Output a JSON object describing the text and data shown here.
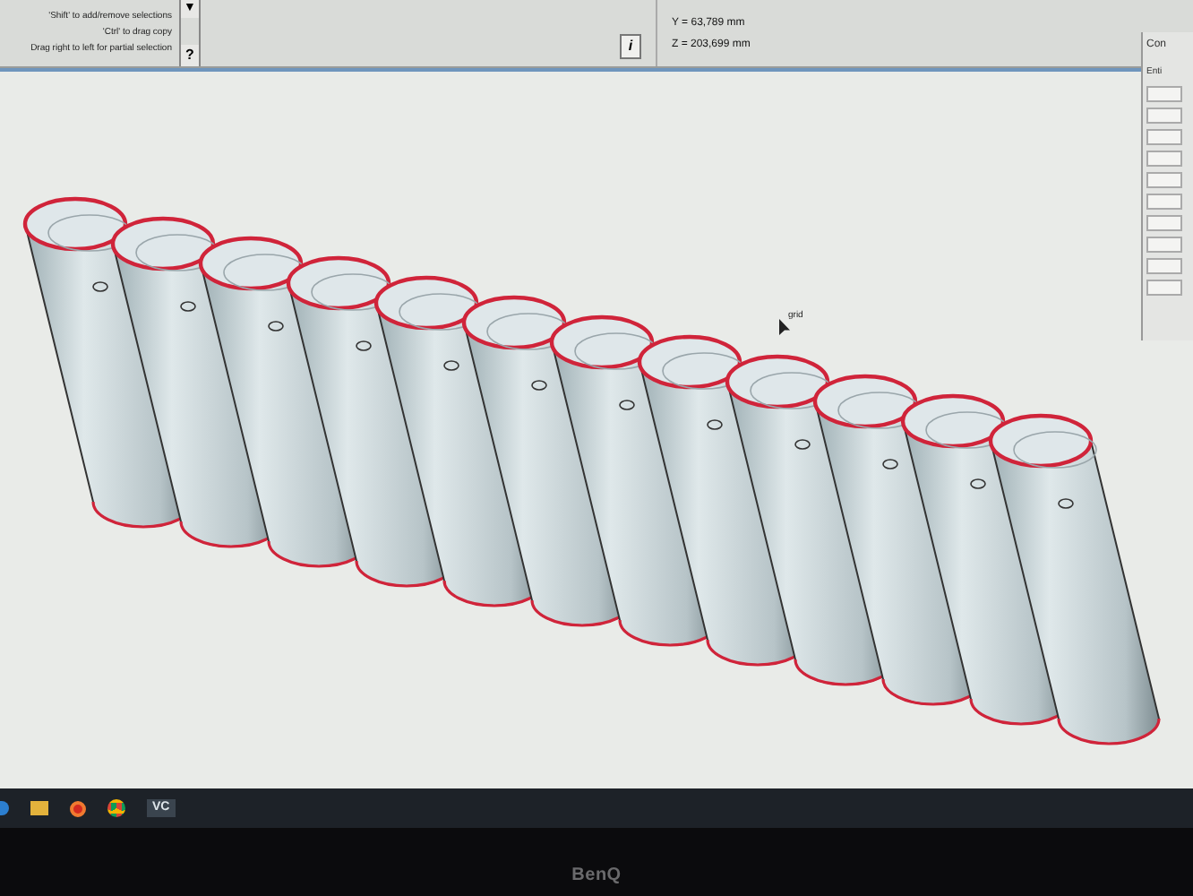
{
  "toolbar": {
    "hints": [
      "'Shift' to add/remove selections",
      "'Ctrl' to drag copy",
      "Drag right to left for partial selection"
    ],
    "dropdown_glyph": "▼",
    "help_glyph": "?",
    "info_glyph": "i",
    "coordinates": [
      "Y = 63,789 mm",
      "Z = 203,699 mm"
    ]
  },
  "side_panel": {
    "title": "Con",
    "header": "Enti"
  },
  "viewport": {
    "cursor_label": "grid"
  },
  "taskbar": {
    "app_label": "VC"
  },
  "monitor": {
    "brand": "BenQ"
  }
}
